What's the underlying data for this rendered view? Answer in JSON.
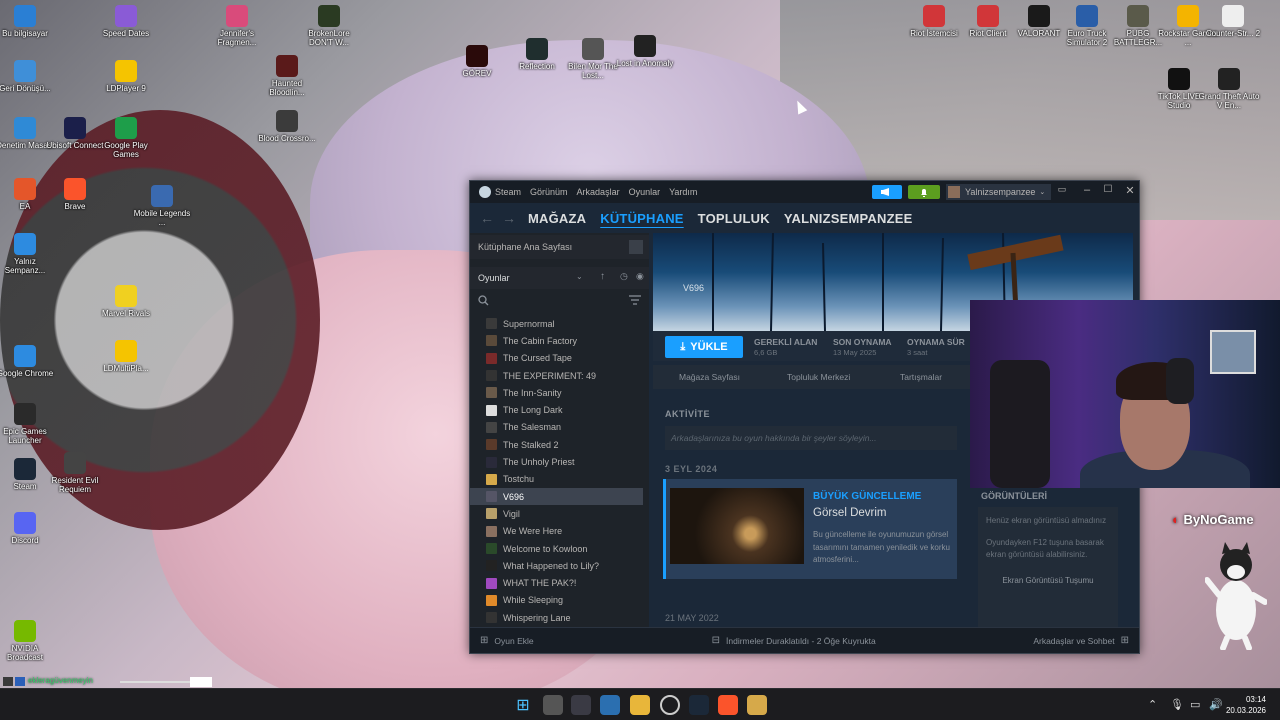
{
  "desktop_icons": [
    {
      "label": "Bu bilgisayar",
      "icon": "computer-icon",
      "color": "#2a7fd4"
    },
    {
      "label": "Speed Dates",
      "icon": "game-icon",
      "color": "#8a5bd6"
    },
    {
      "label": "Jennifer's Fragmen...",
      "icon": "game-icon",
      "color": "#d94b7b"
    },
    {
      "label": "BrokenLore DON'T W...",
      "icon": "game-icon",
      "color": "#2a3a22"
    },
    {
      "label": "Geri Dönüşü...",
      "icon": "recycle-bin-icon",
      "color": "#3f8fd8"
    },
    {
      "label": "LDPlayer 9",
      "icon": "ldplayer-icon",
      "color": "#f5c400"
    },
    {
      "label": "Haunted Bloodlin...",
      "icon": "game-icon",
      "color": "#5a1a1a"
    },
    {
      "label": "Denetim Masası",
      "icon": "control-panel-icon",
      "color": "#2f8ad6"
    },
    {
      "label": "Ubisoft Connect",
      "icon": "ubisoft-icon",
      "color": "#1b1f4a"
    },
    {
      "label": "Google Play Games",
      "icon": "google-play-icon",
      "color": "#1e9e4a"
    },
    {
      "label": "Blood Crossro...",
      "icon": "game-icon",
      "color": "#3b3b3b"
    },
    {
      "label": "EA",
      "icon": "ea-icon",
      "color": "#e4562a"
    },
    {
      "label": "Brave",
      "icon": "brave-icon",
      "color": "#fb542b"
    },
    {
      "label": "Mobile Legends ...",
      "icon": "game-icon",
      "color": "#3a6ab0"
    },
    {
      "label": "Yalnız Sempanz...",
      "icon": "chrome-icon",
      "color": "#2d8be0"
    },
    {
      "label": "Marvel Rivals",
      "icon": "game-icon",
      "color": "#f0d020"
    },
    {
      "label": "Google Chrome",
      "icon": "chrome-icon",
      "color": "#2d8be0"
    },
    {
      "label": "LDMultiPla...",
      "icon": "ldplayer-icon",
      "color": "#f5c400"
    },
    {
      "label": "Epic Games Launcher",
      "icon": "epic-icon",
      "color": "#2a2a2a"
    },
    {
      "label": "Resident Evil Requiem",
      "icon": "game-icon",
      "color": "#444"
    },
    {
      "label": "Steam",
      "icon": "steam-icon",
      "color": "#1b2838"
    },
    {
      "label": "Discord",
      "icon": "discord-icon",
      "color": "#5865f2"
    },
    {
      "label": "NVIDIA Broadcast",
      "icon": "nvidia-icon",
      "color": "#76b900"
    },
    {
      "label": "GÖREV",
      "icon": "game-icon",
      "color": "#2a0a0a"
    },
    {
      "label": "Reflection",
      "icon": "game-icon",
      "color": "#1f2e2e"
    },
    {
      "label": "Bilen Mor The Lost...",
      "icon": "game-icon",
      "color": "#555"
    },
    {
      "label": "Lost in Anomaly",
      "icon": "game-icon",
      "color": "#222"
    },
    {
      "label": "Riot İstemcisi",
      "icon": "riot-icon",
      "color": "#d13639"
    },
    {
      "label": "Riot Client",
      "icon": "riot-icon",
      "color": "#d13639"
    },
    {
      "label": "VALORANT",
      "icon": "valorant-icon",
      "color": "#1a1a1a"
    },
    {
      "label": "Euro Truck Simulator 2",
      "icon": "game-icon",
      "color": "#2a5ea8"
    },
    {
      "label": "PUBG BATTLEGR...",
      "icon": "game-icon",
      "color": "#5a5a4a"
    },
    {
      "label": "Rockstar Games ...",
      "icon": "rockstar-icon",
      "color": "#f4b400"
    },
    {
      "label": "Counter-Str... 2",
      "icon": "file-icon",
      "color": "#eeeeee"
    },
    {
      "label": "TikTok LIVE Studio",
      "icon": "tiktok-icon",
      "color": "#111"
    },
    {
      "label": "Grand Theft Auto V En...",
      "icon": "gta-icon",
      "color": "#222"
    }
  ],
  "steam": {
    "menu": [
      "Steam",
      "Görünüm",
      "Arkadaşlar",
      "Oyunlar",
      "Yardım"
    ],
    "username": "Yalnizsempanzee",
    "nav": [
      "MAĞAZA",
      "KÜTÜPHANE",
      "TOPLULUK",
      "YALNIZSEMPANZEE"
    ],
    "home_label": "Kütüphane Ana Sayfası",
    "filter_label": "Oyunlar",
    "games": [
      "Supernormal",
      "The Cabin Factory",
      "The Cursed Tape",
      "THE EXPERIMENT: 49",
      "The Inn-Sanity",
      "The Long Dark",
      "The Salesman",
      "The Stalked 2",
      "The Unholy Priest",
      "Tostchu",
      "V696",
      "Vigil",
      "We Were Here",
      "Welcome to Kowloon",
      "What Happened to Lily?",
      "WHAT THE PAK?!",
      "While Sleeping",
      "Whispering Lane"
    ],
    "selected_game": "V696",
    "hero_logo": "V696",
    "install_label": "YÜKLE",
    "stats": [
      {
        "label": "GEREKLİ ALAN",
        "value": "6,6 GB"
      },
      {
        "label": "SON OYNAMA",
        "value": "13 May 2025"
      },
      {
        "label": "OYNAMA SÜR",
        "value": "3 saat"
      }
    ],
    "sub_tabs": [
      "Mağaza Sayfası",
      "Topluluk Merkezi",
      "Tartışmalar"
    ],
    "activity_header": "AKTİVİTE",
    "activity_placeholder": "Arkadaşlarınıza bu oyun hakkında bir şeyler söyleyin...",
    "date1": "3 EYL 2024",
    "news": {
      "tag": "BÜYÜK GÜNCELLEME",
      "title": "Görsel Devrim",
      "body": "Bu güncelleme ile oyunumuzun görsel tasarımını tamamen yeniledik ve korku atmosferini..."
    },
    "date2": "21 MAY 2022",
    "screenshots": {
      "header": "GÖRÜNTÜLERİ",
      "empty": "Henüz ekran görüntüsü almadınız",
      "hint": "Oyundayken F12 tuşuna basarak ekran görüntüsü alabilirsiniz.",
      "button": "Ekran Görüntüsü Tuşumu"
    },
    "add_game": "Oyun Ekle",
    "downloads": "İndirmeler Duraklatıldı - 2 Öğe Kuyrukta",
    "friends": "Arkadaşlar ve Sohbet"
  },
  "overlay": {
    "brand": "ByNoGame",
    "stream_user": "ekleragüvenmeyin"
  },
  "taskbar": {
    "time": "03:14",
    "date": "20.03.2026"
  }
}
